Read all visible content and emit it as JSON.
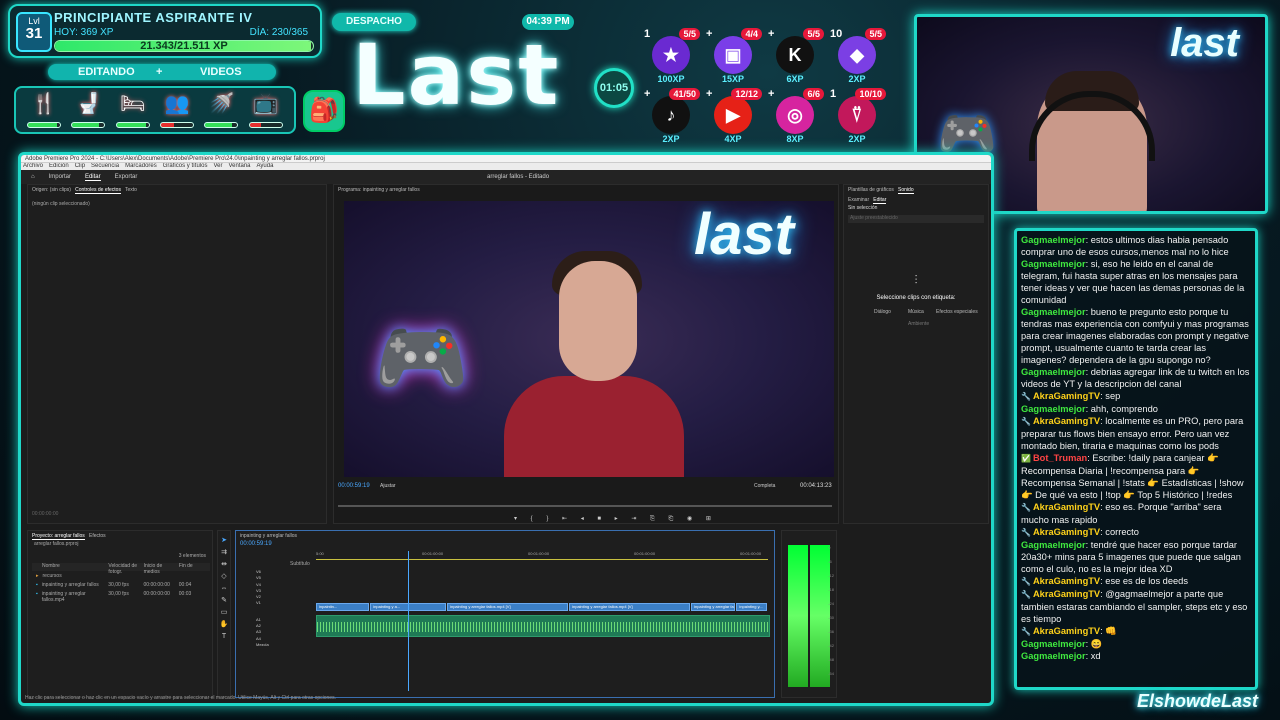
{
  "level": {
    "label": "Lvl",
    "number": "31",
    "title": "PRINCIPIANTE ASPIRANTE IV",
    "today": "HOY: 369 XP",
    "day": "DÍA: 230/365",
    "xp_text": "21.343/21.511 XP",
    "xp_progress": 0.9922
  },
  "modes": {
    "left": "EDITANDO",
    "plus": "+",
    "right": "VIDEOS"
  },
  "needs": [
    {
      "icon": "fork-knife-icon",
      "glyph": "🍴",
      "level": 0.9,
      "color": "#34e05a"
    },
    {
      "icon": "toilet-icon",
      "glyph": "🚽",
      "level": 0.85,
      "color": "#34e05a"
    },
    {
      "icon": "bed-icon",
      "glyph": "🛏",
      "level": 0.9,
      "color": "#34e05a"
    },
    {
      "icon": "people-icon",
      "glyph": "👥",
      "level": 0.4,
      "color": "#e63030"
    },
    {
      "icon": "shower-icon",
      "glyph": "🚿",
      "level": 0.85,
      "color": "#34e05a"
    },
    {
      "icon": "tv-icon",
      "glyph": "📺",
      "level": 0.35,
      "color": "#e63030"
    }
  ],
  "room": "DESPACHO",
  "title": "Last",
  "clock": "04:39 PM",
  "timer": "01:05",
  "socials": [
    {
      "icon": "star-icon",
      "glyph": "★",
      "pre": "1",
      "count": "5/5",
      "xp": "100XP",
      "bg": "#6a2ad1"
    },
    {
      "icon": "twitch-icon",
      "glyph": "▣",
      "pre": "+",
      "count": "4/4",
      "xp": "15XP",
      "bg": "#7a3ee8"
    },
    {
      "icon": "kick-icon",
      "glyph": "K",
      "pre": "+",
      "count": "5/5",
      "xp": "6XP",
      "bg": "#111111"
    },
    {
      "icon": "ethereum-icon",
      "glyph": "◆",
      "pre": "10",
      "count": "5/5",
      "xp": "2XP",
      "bg": "#7b3fe4"
    },
    {
      "icon": "tiktok-icon",
      "glyph": "♪",
      "pre": "+",
      "count": "41/50",
      "xp": "2XP",
      "bg": "#111111"
    },
    {
      "icon": "youtube-icon",
      "glyph": "▶",
      "pre": "+",
      "count": "12/12",
      "xp": "4XP",
      "bg": "#e62117"
    },
    {
      "icon": "instagram-icon",
      "glyph": "◎",
      "pre": "+",
      "count": "6/6",
      "xp": "8XP",
      "bg": "#d6249f"
    },
    {
      "icon": "drop-icon",
      "glyph": "⍢",
      "pre": "1",
      "count": "10/10",
      "xp": "2XP",
      "bg": "#c2185b"
    }
  ],
  "editor": {
    "titlebar": "Adobe Premiere Pro 2024 - C:\\Users\\Alex\\Documents\\Adobe\\Premiere Pro\\24.0\\inpainting y arreglar fallos.prproj",
    "menu": [
      "Archivo",
      "Edición",
      "Clip",
      "Secuencia",
      "Marcadores",
      "Gráficos y títulos",
      "Ver",
      "Ventana",
      "Ayuda"
    ],
    "nav": {
      "home": "⌂",
      "import": "Importar",
      "edit": "Editar",
      "export": "Exportar",
      "center": "arreglar fallos - Editado"
    },
    "source_tabs": [
      "Origen: (sin clips)",
      "Controles de efectos",
      "Texto"
    ],
    "source_empty": "(ningún clip seleccionado)",
    "source_time": "00:00:00:00",
    "program_tab": "Programa: inpainting y arreglar fallos",
    "program_timecode": "00:00:59:19",
    "program_fit": "Ajustar",
    "program_quality": "Completa",
    "program_duration": "00:04:13:23",
    "right_tabs": [
      "Plantillas de gráficos",
      "Sonido"
    ],
    "right_subtabs": [
      "Examinar",
      "Editar"
    ],
    "right_no_selection": "Sin selección",
    "right_preset": "Ajuste preestablecido",
    "right_prompt": "Seleccione clips con etiqueta:",
    "right_options": [
      "Diálogo",
      "Música",
      "Efectos especiales",
      "Ambiente"
    ],
    "project_tabs": [
      "Proyecto: arreglar fallos",
      "Efectos"
    ],
    "project_path": "arreglar fallos.prproj",
    "project_count": "3 elementos",
    "project_cols": [
      "Nombre",
      "Velocidad de fotogr.",
      "Inicio de medios",
      "Fin de"
    ],
    "project_rows": [
      {
        "name": "recursos",
        "fps": "",
        "start": "",
        "end": ""
      },
      {
        "name": "inpainting y arreglar fallos",
        "fps": "30,00 fps",
        "start": "00:00:00:00",
        "end": "00:04"
      },
      {
        "name": "inpainting y arreglar fallos.mp4",
        "fps": "30,00 fps",
        "start": "00:00:00:00",
        "end": "00:03"
      }
    ],
    "timeline_tab": "inpainting y arreglar fallos",
    "timeline_time": "00:00:59:19",
    "timeline_ticks": [
      "5:00",
      "00:01:00:00",
      "00:01:00:00",
      "00:01:00:00",
      "00:01:00:00"
    ],
    "tracks": [
      "V6",
      "V5",
      "V4",
      "V3",
      "V2",
      "V1",
      "A1",
      "A2",
      "A3",
      "A4",
      "Mezcla"
    ],
    "subtitle": "Subtítulo",
    "clips": [
      "inpaintin...",
      "inpainting y a...",
      "inpainting y arreglar fallos.mp4 [V]",
      "inpainting y arreglar fallos.mp4 [V]",
      "inpainting y arreglar fallos.mp4 [V]",
      "inpainting y..."
    ],
    "meter_scale": [
      "0",
      "-6",
      "-12",
      "-18",
      "-24",
      "-30",
      "-36",
      "-42",
      "-48",
      "-54"
    ],
    "statusbar": "Haz clic para seleccionar o haz clic en un espacio vacío y arrastre para seleccionar el marcado. Utilice Mayús, Alt y Ctrl para otras opciones."
  },
  "chat": [
    {
      "user": "Gagmaelmejor",
      "color": "g",
      "badge": "",
      "text": ": estos ultimos dias habia pensado comprar uno de esos cursos,menos mal no lo hice"
    },
    {
      "user": "Gagmaelmejor",
      "color": "g",
      "badge": "",
      "text": ": si, eso he leido en el canal de telegram, fui hasta super atras en los mensajes para tener ideas y ver que hacen las demas personas de la comunidad"
    },
    {
      "user": "Gagmaelmejor",
      "color": "g",
      "badge": "",
      "text": ": bueno te pregunto esto porque tu tendras mas experiencia con comfyui y mas programas para crear imagenes elaboradas con prompt y negative prompt, usualmente cuanto te tarda crear las imagenes? dependera de la gpu supongo no?"
    },
    {
      "user": "Gagmaelmejor",
      "color": "g",
      "badge": "",
      "text": ": debrias agregar link de tu twitch en los videos de YT y la descripcion del canal"
    },
    {
      "user": "AkraGamingTV",
      "color": "a",
      "badge": "🔧",
      "text": ": sep"
    },
    {
      "user": "Gagmaelmejor",
      "color": "g",
      "badge": "",
      "text": ": ahh, comprendo"
    },
    {
      "user": "AkraGamingTV",
      "color": "a",
      "badge": "🔧",
      "text": ": localmente es un PRO, pero para preparar tus flows bien ensayo error. Pero uan vez montado bien, tiraria e maquinas como los pods"
    },
    {
      "user": "Bot_Truman",
      "color": "b",
      "badge": "✅",
      "text": ": Escribe: !daily para canjear 👉 Recompensa Diaria | !recompensa para 👉 Recompensa Semanal | !stats 👉 Estadísticas | !show 👉 De qué va esto | !top 👉 Top 5 Histórico | !redes"
    },
    {
      "user": "AkraGamingTV",
      "color": "a",
      "badge": "🔧",
      "text": ": eso es. Porque \"arriba\" sera mucho mas rapido"
    },
    {
      "user": "AkraGamingTV",
      "color": "a",
      "badge": "🔧",
      "text": ": correcto"
    },
    {
      "user": "Gagmaelmejor",
      "color": "g",
      "badge": "",
      "text": ": tendré que hacer eso porque tardar 20a30+ mins para 5 imagenes que puede que salgan como el culo, no es la mejor idea XD"
    },
    {
      "user": "AkraGamingTV",
      "color": "a",
      "badge": "🔧",
      "text": ": ese es de los deeds"
    },
    {
      "user": "AkraGamingTV",
      "color": "a",
      "badge": "🔧",
      "text": ": @gagmaelmejor a parte que tambien estaras cambiando el sampler, steps etc y eso es tiempo"
    },
    {
      "user": "AkraGamingTV",
      "color": "a",
      "badge": "🔧",
      "text": ": 👊"
    },
    {
      "user": "Gagmaelmejor",
      "color": "g",
      "badge": "",
      "text": ": 😄"
    },
    {
      "user": "Gagmaelmejor",
      "color": "g",
      "badge": "",
      "text": ": xd"
    }
  ],
  "brand": "ElshowdeLast",
  "cam_sign": "last",
  "colors": {
    "accent": "#1fd8c8",
    "xp": "#2ee86a",
    "user_g": "#3fe83f",
    "user_a": "#ffd21a",
    "user_b": "#ff4444"
  }
}
